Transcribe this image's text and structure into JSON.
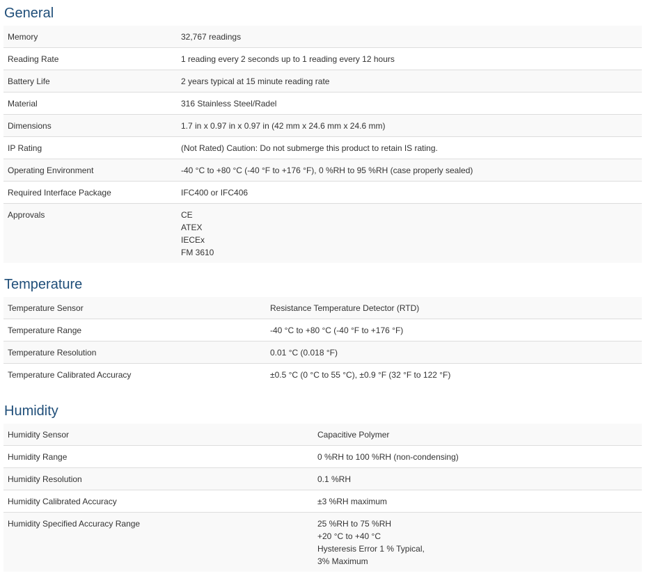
{
  "general": {
    "title": "General",
    "rows": [
      {
        "label": "Memory",
        "value": [
          "32,767 readings"
        ]
      },
      {
        "label": "Reading Rate",
        "value": [
          "1 reading every 2 seconds up to 1 reading every 12 hours"
        ]
      },
      {
        "label": "Battery Life",
        "value": [
          "2 years typical at 15 minute reading rate"
        ]
      },
      {
        "label": "Material",
        "value": [
          "316 Stainless Steel/Radel"
        ]
      },
      {
        "label": "Dimensions",
        "value": [
          "1.7 in x 0.97 in x 0.97 in (42 mm x 24.6 mm x 24.6 mm)"
        ]
      },
      {
        "label": "IP Rating",
        "value": [
          "(Not Rated) Caution: Do not submerge this product to retain IS rating."
        ]
      },
      {
        "label": "Operating Environment",
        "value": [
          "-40 °C to +80 °C (-40 °F to +176 °F), 0 %RH to 95 %RH (case properly sealed)"
        ]
      },
      {
        "label": "Required Interface Package",
        "value": [
          "IFC400 or IFC406"
        ]
      },
      {
        "label": "Approvals",
        "value": [
          "CE",
          "ATEX",
          "IECEx",
          "FM 3610"
        ]
      }
    ]
  },
  "temperature": {
    "title": "Temperature",
    "rows": [
      {
        "label": "Temperature Sensor",
        "value": [
          "Resistance Temperature Detector (RTD)"
        ]
      },
      {
        "label": "Temperature Range",
        "value": [
          "-40 °C to +80 °C (-40 °F to +176 °F)"
        ]
      },
      {
        "label": "Temperature Resolution",
        "value": [
          "0.01 °C (0.018 °F)"
        ]
      },
      {
        "label": "Temperature Calibrated Accuracy",
        "value": [
          "±0.5 °C (0 °C to 55 °C), ±0.9 °F (32 °F to 122 °F)"
        ]
      }
    ]
  },
  "humidity": {
    "title": "Humidity",
    "rows": [
      {
        "label": "Humidity Sensor",
        "value": [
          "Capacitive Polymer"
        ]
      },
      {
        "label": "Humidity Range",
        "value": [
          "0 %RH to 100 %RH (non-condensing)"
        ]
      },
      {
        "label": "Humidity Resolution",
        "value": [
          "0.1 %RH"
        ]
      },
      {
        "label": "Humidity Calibrated Accuracy",
        "value": [
          "±3 %RH maximum"
        ]
      },
      {
        "label": "Humidity Specified Accuracy Range",
        "value": [
          "25 %RH to 75 %RH",
          "+20 °C to +40 °C",
          "Hysteresis Error 1 % Typical,",
          "3% Maximum"
        ]
      }
    ]
  },
  "colors": {
    "heading": "#1f4e79",
    "text": "#333333",
    "row_stripe": "#f9f9f9",
    "row_border": "#dddddd"
  }
}
